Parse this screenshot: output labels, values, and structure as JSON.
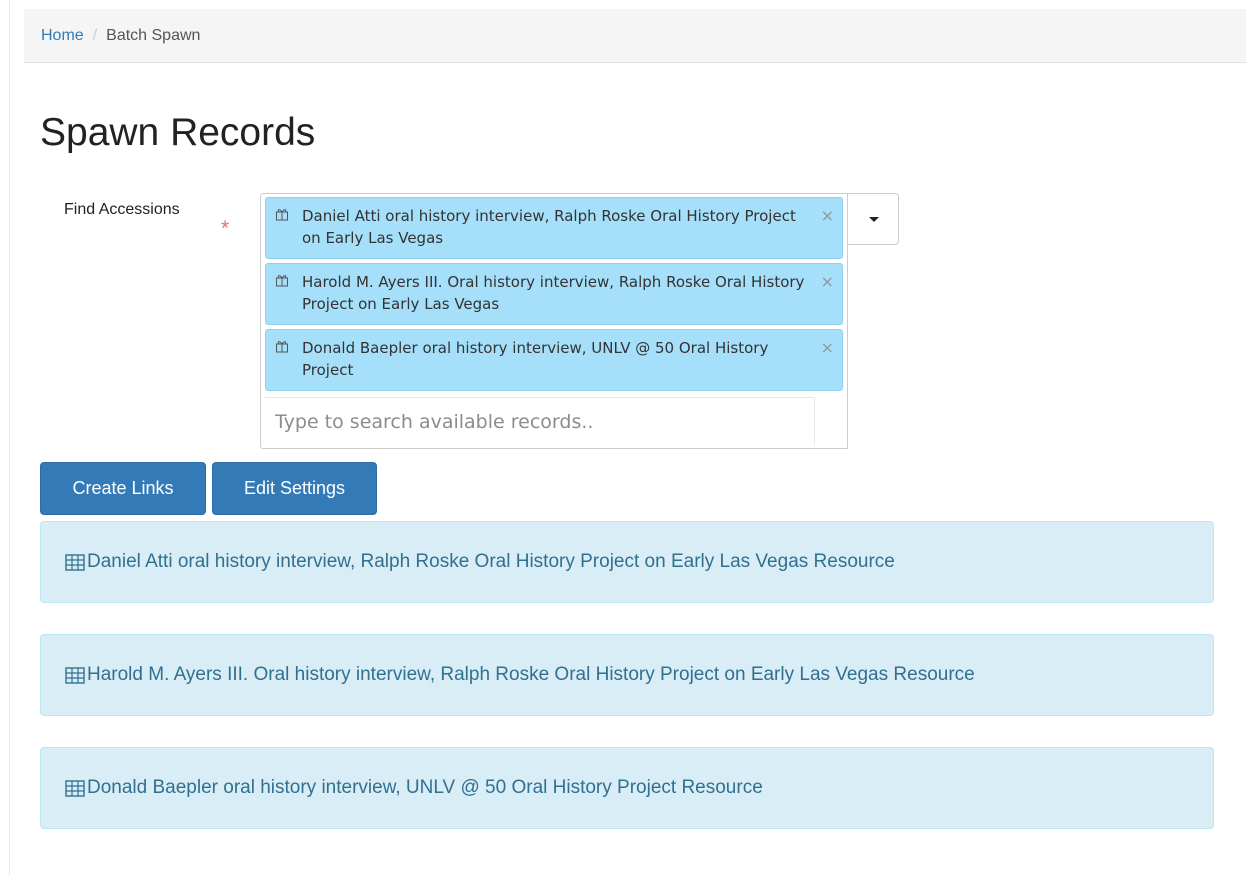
{
  "breadcrumb": {
    "home": "Home",
    "separator": "/",
    "current": "Batch Spawn"
  },
  "page": {
    "title": "Spawn Records"
  },
  "form": {
    "label": "Find Accessions",
    "required_marker": "*",
    "search_placeholder": "Type to search available records..",
    "tokens": [
      {
        "text": "Daniel Atti oral history interview, Ralph Roske Oral History Project on Early Las Vegas",
        "icon": "accession-gift-icon",
        "remove": "×"
      },
      {
        "text": "Harold M. Ayers III. Oral history interview, Ralph Roske Oral History Project on Early Las Vegas",
        "icon": "accession-gift-icon",
        "remove": "×"
      },
      {
        "text": "Donald Baepler oral history interview, UNLV @ 50 Oral History Project",
        "icon": "accession-gift-icon",
        "remove": "×"
      }
    ]
  },
  "buttons": {
    "create_links": "Create Links",
    "edit_settings": "Edit Settings"
  },
  "results": [
    {
      "text": "Daniel Atti oral history interview, Ralph Roske Oral History Project on Early Las Vegas Resource",
      "icon": "table-icon"
    },
    {
      "text": "Harold M. Ayers III. Oral history interview, Ralph Roske Oral History Project on Early Las Vegas Resource",
      "icon": "table-icon"
    },
    {
      "text": "Donald Baepler oral history interview, UNLV @ 50 Oral History Project Resource",
      "icon": "table-icon"
    }
  ],
  "colors": {
    "primary": "#337ab7",
    "token_bg": "#a5dff9",
    "info_bg": "#d9edf7",
    "info_text": "#31708f",
    "required": "#e3716f"
  }
}
